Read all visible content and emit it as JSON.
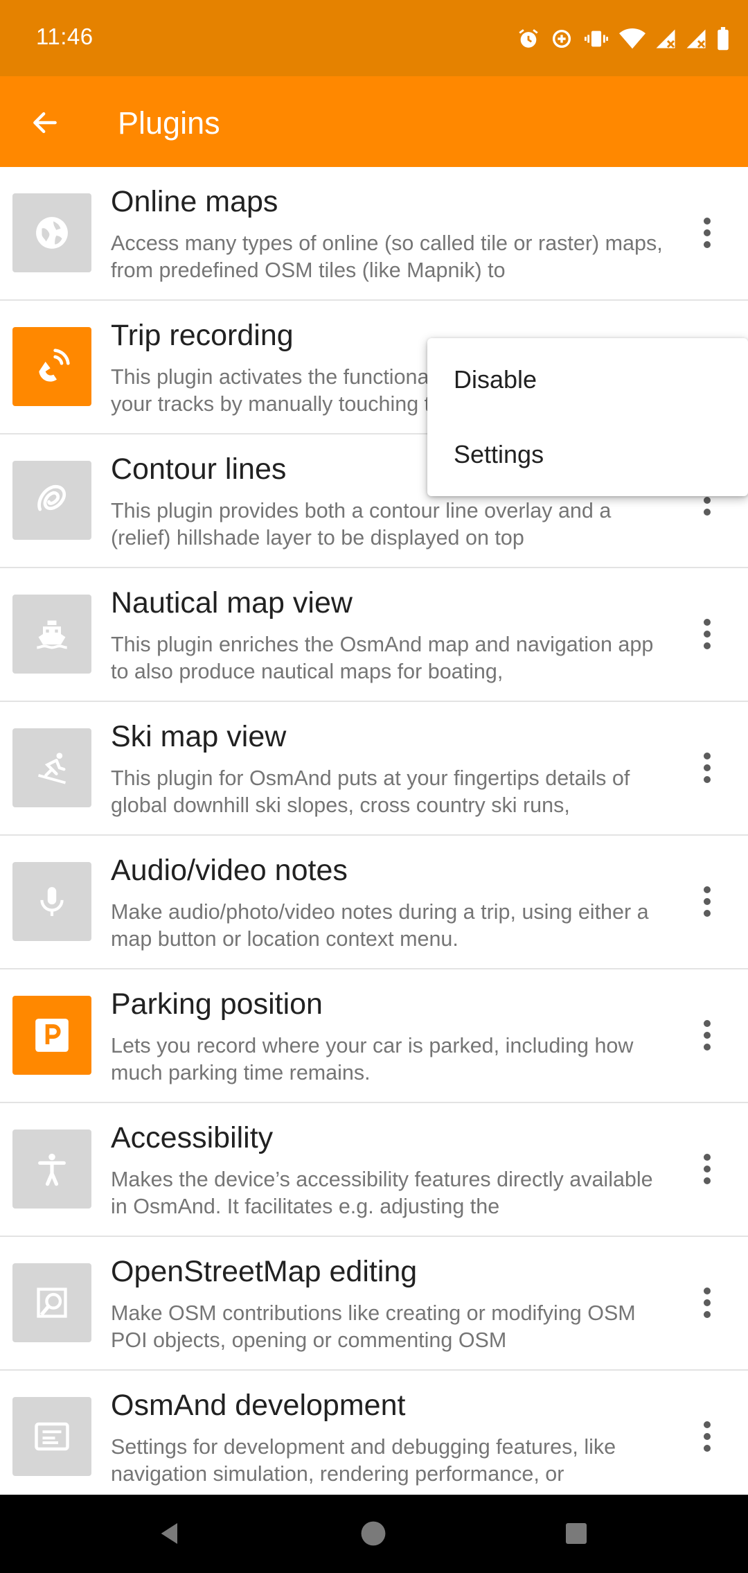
{
  "status": {
    "time": "11:46",
    "icons": [
      "alarm-icon",
      "data-saver-icon",
      "vibrate-icon",
      "wifi-icon",
      "signal-icon",
      "signal-x-icon",
      "battery-icon"
    ]
  },
  "app_bar": {
    "title": "Plugins",
    "back_icon": "arrow-back-icon"
  },
  "plugins": [
    {
      "title": "Online maps",
      "description": "Access many types of online (so called tile or raster) maps, from predefined OSM tiles (like Mapnik) to",
      "icon": "globe-icon",
      "enabled": false
    },
    {
      "title": "Trip recording",
      "description": "This plugin activates the functionality to record and save your tracks by manually touching the",
      "icon": "trip-recording-icon",
      "enabled": true
    },
    {
      "title": "Contour lines",
      "description": "This plugin provides both a contour line overlay and a (relief) hillshade layer to be displayed on top",
      "icon": "contour-icon",
      "enabled": false
    },
    {
      "title": "Nautical map view",
      "description": "This plugin enriches the OsmAnd map and navigation app to also produce nautical maps for boating,",
      "icon": "ship-icon",
      "enabled": false
    },
    {
      "title": "Ski map view",
      "description": "This plugin for OsmAnd puts at your fingertips details of global downhill ski slopes, cross country ski runs,",
      "icon": "skier-icon",
      "enabled": false
    },
    {
      "title": "Audio/video notes",
      "description": "Make audio/photo/video notes during a trip, using either a map button or location context menu.",
      "icon": "microphone-icon",
      "enabled": false
    },
    {
      "title": "Parking position",
      "description": "Lets you record where your car is parked, including how much parking time remains.",
      "icon": "parking-icon",
      "enabled": true
    },
    {
      "title": "Accessibility",
      "description": "Makes the device’s accessibility features directly available in OsmAnd. It facilitates e.g. adjusting the",
      "icon": "accessibility-icon",
      "enabled": false
    },
    {
      "title": "OpenStreetMap editing",
      "description": "Make OSM contributions like creating or modifying OSM POI objects, opening or commenting OSM",
      "icon": "osm-edit-icon",
      "enabled": false
    },
    {
      "title": "OsmAnd development",
      "description": "Settings for development and debugging features, like navigation simulation, rendering performance, or",
      "icon": "development-icon",
      "enabled": false
    }
  ],
  "context_menu": {
    "items": [
      "Disable",
      "Settings"
    ]
  },
  "colors": {
    "status_bar": "#e58200",
    "app_bar": "#ff8800",
    "active_icon_bg": "#ff8800",
    "inactive_icon_bg": "#d6d6d6"
  }
}
